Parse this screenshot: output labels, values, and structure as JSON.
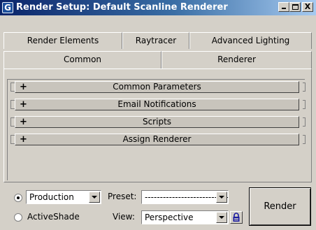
{
  "window": {
    "title": "Render Setup: Default Scanline Renderer",
    "controls": {
      "minimize": "_",
      "maximize": "□",
      "close": "X"
    }
  },
  "tabs": {
    "row1": [
      "Render Elements",
      "Raytracer",
      "Advanced Lighting"
    ],
    "row2": [
      "Common",
      "Renderer"
    ],
    "active": "Common"
  },
  "rollouts": [
    {
      "label": "Common Parameters",
      "state": "+"
    },
    {
      "label": "Email Notifications",
      "state": "+"
    },
    {
      "label": "Scripts",
      "state": "+"
    },
    {
      "label": "Assign Renderer",
      "state": "+"
    }
  ],
  "bottom": {
    "mode_options": [
      "Production",
      "ActiveShade"
    ],
    "mode_selected": "Production",
    "production_combo_value": "Production",
    "preset_label": "Preset:",
    "preset_value": "----------------------------",
    "view_label": "View:",
    "view_value": "Perspective",
    "render_label": "Render"
  },
  "icons": {
    "lock": "lock-icon",
    "app": "render-setup-icon"
  },
  "colors": {
    "titlebar_start": "#0a246a",
    "titlebar_end": "#a6caf0",
    "lock": "#1a1aa0",
    "face": "#d4d0c8"
  }
}
